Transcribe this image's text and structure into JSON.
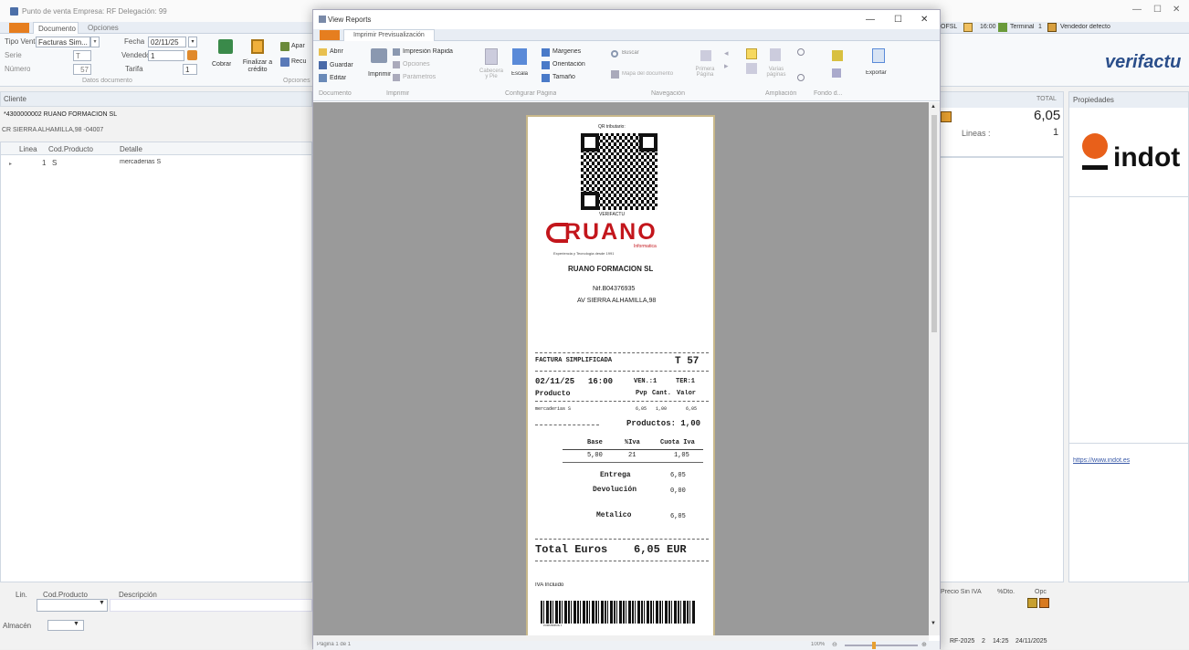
{
  "main": {
    "title": "Punto de venta Empresa: RF Delegación: 99",
    "tabs": [
      "Documento",
      "Opciones"
    ],
    "fields": {
      "tipo_venta_label": "Tipo Venta",
      "tipo_venta_value": "Facturas Sim...",
      "serie_label": "Serie",
      "serie_value": "T",
      "numero_label": "Número",
      "numero_value": "57",
      "fecha_label": "Fecha",
      "fecha_value": "02/11/25",
      "vendedor_label": "Vendedor",
      "vendedor_value": "1",
      "tarifa_label": "Tarifa",
      "tarifa_value": "1"
    },
    "group_datos": "Datos documento",
    "group_opciones": "Opciones",
    "buttons": {
      "cobrar": "Cobrar",
      "finalizar": "Finalizar a crédito",
      "apar": "Apar",
      "recu": "Recu"
    },
    "cliente_label": "Cliente",
    "cliente_value": "*4300000002 RUANO FORMACION SL",
    "direccion_value": "CR SIERRA ALHAMILLA,98 -04007",
    "grid_headers": [
      "Linea",
      "Cod.Producto",
      "Detalle"
    ],
    "grid_rows": [
      {
        "linea": "1",
        "cod": "S",
        "detalle": "mercaderias S"
      }
    ],
    "bottom_headers": [
      "Lin.",
      "Cod.Producto",
      "Descripción"
    ],
    "almacen_label": "Almacén",
    "total_label": "TOTAL",
    "total_value": "6,05",
    "lineas_label": "Lineas :",
    "lineas_value": "1",
    "propiedades_label": "Propiedades",
    "brand_verifactu": "verifactu",
    "brand_indot": "indot",
    "indot_link": "https://www.indot.es",
    "right_headers": [
      "Precio Sin IVA",
      "%Dto.",
      "Opc"
    ],
    "top_status": {
      "ofs": "OFSL",
      "time": "16:00",
      "terminal": "Terminal",
      "terminal_num": "1",
      "vendedor": "Vendedor defecto"
    },
    "status": {
      "rf": "RF-2025",
      "num": "2",
      "time": "14:25",
      "date": "24/11/2025"
    },
    "win_controls": [
      "—",
      "☐",
      "✕"
    ]
  },
  "reports": {
    "title": "View Reports",
    "tab": "Imprimir Previsualización",
    "groups": [
      "Documento",
      "Imprimir",
      "Configurar Página",
      "Navegación",
      "Ampliación",
      "Fondo d...",
      ""
    ],
    "documento": [
      "Abrir",
      "Guardar",
      "Editar"
    ],
    "imprimir_big": "Imprimir",
    "imprimir_small": [
      "Impresión Rápida",
      "Opciones",
      "Parámetros"
    ],
    "config_big": [
      "Cabecera y Pie",
      "Escala"
    ],
    "config_small": [
      "Márgenes",
      "Orientación",
      "Tamaño"
    ],
    "nav": [
      "Buscar",
      "Mapa del documento",
      "Primera Página"
    ],
    "zoom": [
      "Varias páginas"
    ],
    "exportar": "Exportar",
    "status_page": "Página 1 de 1",
    "status_zoom": "100%",
    "controls": [
      "—",
      "☐",
      "✕"
    ]
  },
  "receipt": {
    "qr_caption": "QR tributario:",
    "verifactu": "VERIFACTU",
    "logo": "RUANO",
    "logo_sub": "Informatica",
    "logo_tag": "Experiencia y Tecnología desde 1991",
    "company": "RUANO FORMACION SL",
    "nif": "Nif.B04376935",
    "address": "AV SIERRA ALHAMILLA,98",
    "doc_type": "FACTURA SIMPLIFICADA",
    "doc_num": "T 57",
    "date": "02/11/25",
    "time": "16:00",
    "ven": "VEN.:1",
    "ter": "TER:1",
    "headers": [
      "Producto",
      "Pvp",
      "Cant.",
      "Valor"
    ],
    "line_name": "mercaderias S",
    "line_pvp": "6,05",
    "line_cant": "1,00",
    "line_valor": "6,05",
    "productos": "Productos: 1,00",
    "tax_headers": [
      "Base",
      "%Iva",
      "Cuota Iva"
    ],
    "tax_values": [
      "5,00",
      "21",
      "1,05"
    ],
    "entrega_label": "Entrega",
    "entrega_value": "6,05",
    "devolucion_label": "Devolución",
    "devolucion_value": "0,00",
    "metalico_label": "Metalico",
    "metalico_value": "6,05",
    "total_label": "Total Euros",
    "total_value": "6,05 EUR",
    "iva_incl": "IVA Incluido",
    "barcode_text": "T00000057"
  }
}
